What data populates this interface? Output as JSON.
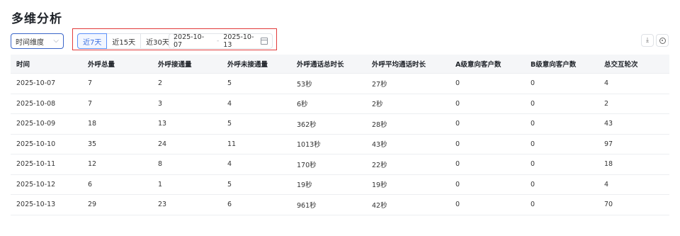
{
  "page": {
    "title": "多维分析"
  },
  "filters": {
    "dimension_select": {
      "value": "时间维度"
    },
    "quick_ranges": [
      {
        "label": "近7天",
        "active": true
      },
      {
        "label": "近15天",
        "active": false
      },
      {
        "label": "近30天",
        "active": false
      }
    ],
    "date_range": {
      "start": "2025-10-07",
      "separator": "-",
      "end": "2025-10-13"
    }
  },
  "toolbar": {
    "download_icon": "download-icon",
    "settings_icon": "settings-icon"
  },
  "colors": {
    "accent": "#3b6fe0",
    "highlight_border": "#e23b3b",
    "header_bg": "#f5f6f8"
  },
  "table": {
    "columns": [
      "时间",
      "外呼总量",
      "外呼接通量",
      "外呼未接通量",
      "外呼通话总时长",
      "外呼平均通话时长",
      "A级意向客户数",
      "B级意向客户数",
      "总交互轮次"
    ],
    "rows": [
      [
        "2025-10-07",
        "7",
        "2",
        "5",
        "53秒",
        "27秒",
        "0",
        "0",
        "4"
      ],
      [
        "2025-10-08",
        "7",
        "3",
        "4",
        "6秒",
        "2秒",
        "0",
        "0",
        "2"
      ],
      [
        "2025-10-09",
        "18",
        "13",
        "5",
        "362秒",
        "28秒",
        "0",
        "0",
        "43"
      ],
      [
        "2025-10-10",
        "35",
        "24",
        "11",
        "1013秒",
        "43秒",
        "0",
        "0",
        "97"
      ],
      [
        "2025-10-11",
        "12",
        "8",
        "4",
        "170秒",
        "22秒",
        "0",
        "0",
        "18"
      ],
      [
        "2025-10-12",
        "6",
        "1",
        "5",
        "19秒",
        "19秒",
        "0",
        "0",
        "4"
      ],
      [
        "2025-10-13",
        "29",
        "23",
        "6",
        "961秒",
        "42秒",
        "0",
        "0",
        "70"
      ]
    ]
  }
}
